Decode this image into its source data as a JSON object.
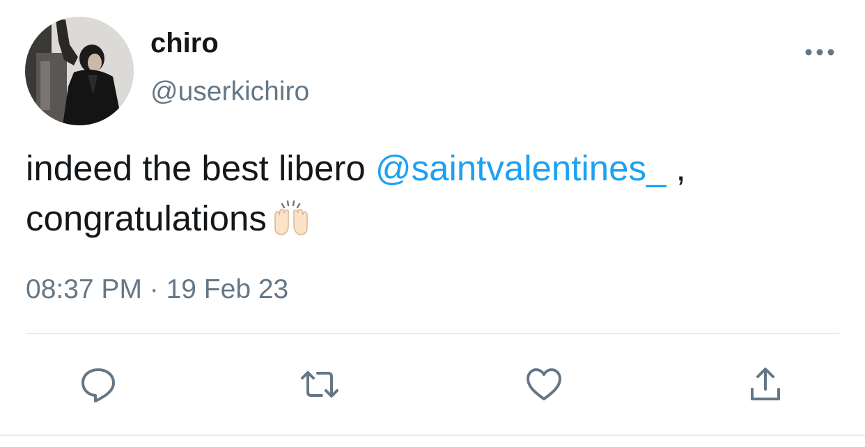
{
  "tweet": {
    "display_name": "chiro",
    "handle": "@userkichiro",
    "text_before": "indeed the best libero ",
    "mention": "@saintvalentines_",
    "text_after": " ,",
    "text_line2": "congratulations",
    "emoji": "raising-hands-emoji",
    "timestamp": "08:37 PM · 19 Feb 23"
  },
  "actions": {
    "reply": "reply-icon",
    "retweet": "retweet-icon",
    "like": "heart-icon",
    "share": "share-icon"
  },
  "colors": {
    "text": "#14171a",
    "secondary": "#657786",
    "mention": "#1da1f2",
    "divider": "#e6ecf0"
  }
}
